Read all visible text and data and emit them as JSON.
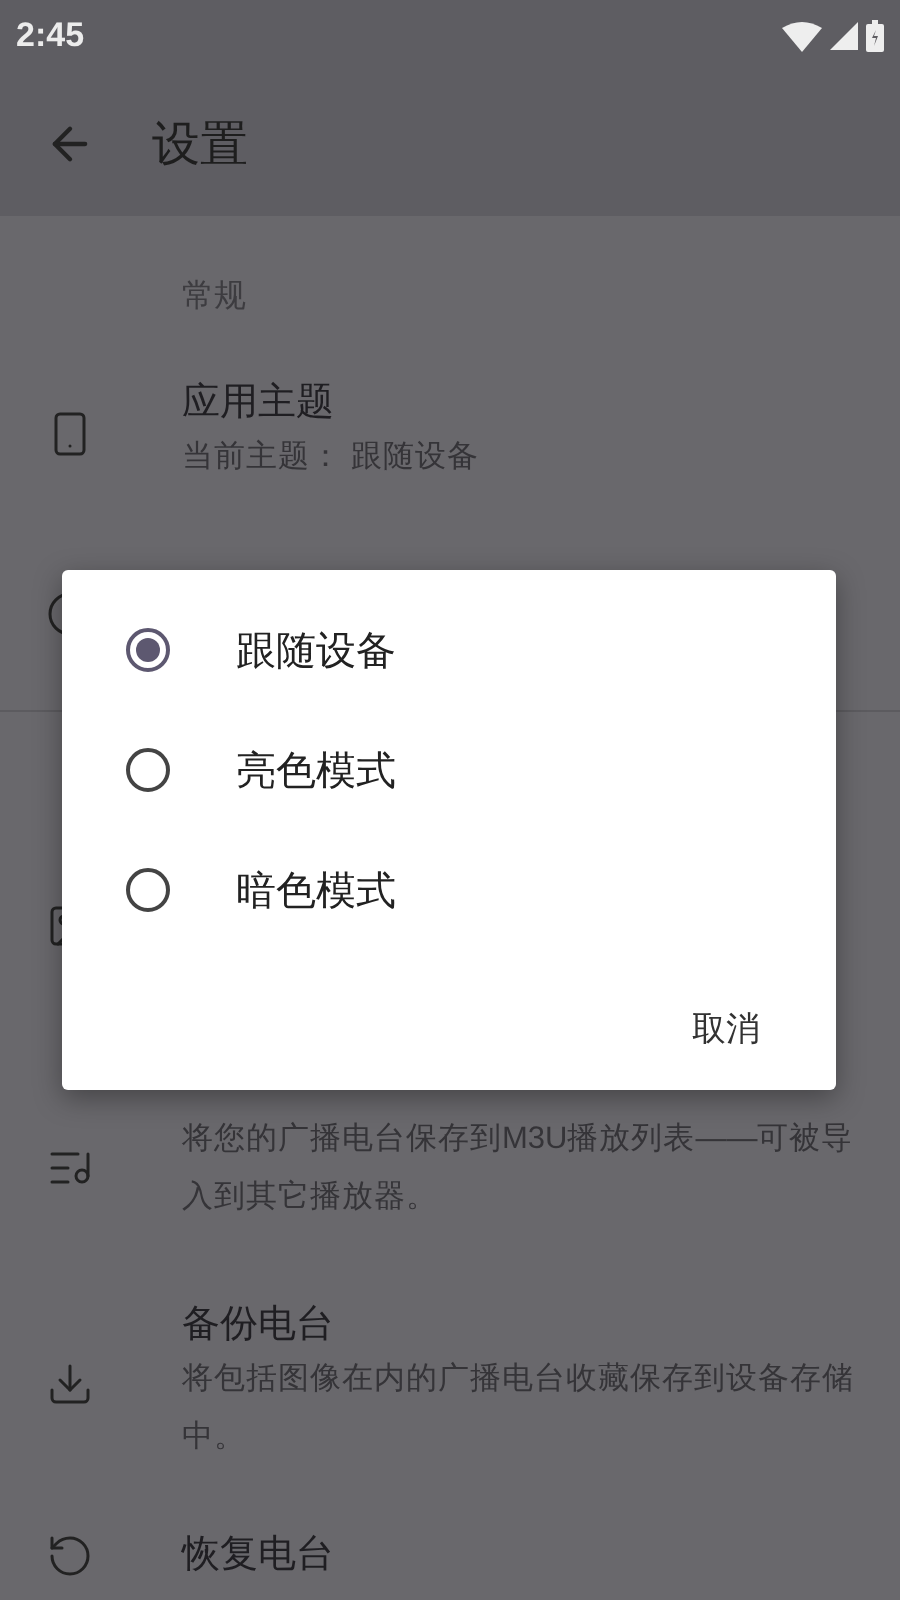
{
  "status_bar": {
    "time": "2:45"
  },
  "app_bar": {
    "title": "设置"
  },
  "section": {
    "header": "常规"
  },
  "rows": [
    {
      "kind": "theme",
      "title": "应用主题",
      "subtitle": "当前主题： 跟随设备"
    },
    {
      "kind": "covered_round"
    },
    {
      "kind": "divider"
    },
    {
      "kind": "covered_square"
    },
    {
      "kind": "export",
      "subtitle": "将您的广播电台保存到M3U播放列表——可被导入到其它播放器。"
    },
    {
      "kind": "backup",
      "title": "备份电台",
      "subtitle": "将包括图像在内的广播电台收藏保存到设备存储中。"
    },
    {
      "kind": "restore",
      "title": "恢复电台"
    }
  ],
  "dialog": {
    "options": [
      {
        "label": "跟随设备",
        "selected": true
      },
      {
        "label": "亮色模式",
        "selected": false
      },
      {
        "label": "暗色模式",
        "selected": false
      }
    ],
    "buttons": [
      "取消"
    ]
  }
}
